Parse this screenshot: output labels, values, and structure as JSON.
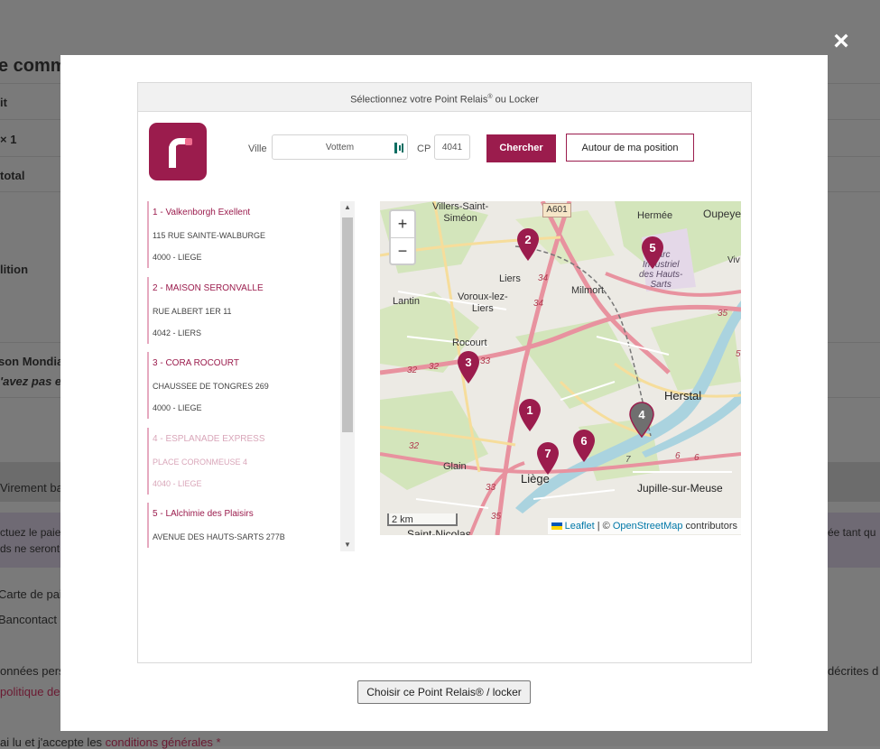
{
  "background": {
    "heading": "e comm",
    "rows": [
      "it",
      "× 1",
      "total",
      "lition",
      "son Mondia",
      "'avez pas e"
    ],
    "payment_row": "Virement ba",
    "note_left1": "ctuez le paie",
    "note_left2": "ds ne seront",
    "note_right": "ée tant qu",
    "card": "Carte de paie",
    "bancontact": "Bancontact",
    "privacy_left": "onnées pers",
    "privacy_link": "politique de",
    "privacy_right": "décrites d",
    "terms_text": "ai lu et j'accepte les",
    "terms_link": "conditions générales",
    "terms_star": "*"
  },
  "dialog": {
    "close_label": "×",
    "header_title": "Sélectionnez votre Point Relais",
    "header_reg": "®",
    "header_suffix": "ou Locker",
    "ville_label": "Ville",
    "ville_value": "Vottem",
    "cp_label": "CP",
    "cp_value": "4041",
    "search_label": "Chercher",
    "position_label": "Autour de ma position",
    "choose_label": "Choisir ce Point Relais® / locker",
    "points": [
      {
        "title": "1 - Valkenborgh Exellent",
        "street": "115 RUE SAINTE-WALBURGE",
        "city": "4000 - LIEGE",
        "disabled": false
      },
      {
        "title": "2 - MAISON SERONVALLE",
        "street": "RUE ALBERT 1ER 11",
        "city": "4042 - LIERS",
        "disabled": false
      },
      {
        "title": "3 - CORA ROCOURT",
        "street": "CHAUSSEE DE TONGRES 269",
        "city": "4000 - LIEGE",
        "disabled": false
      },
      {
        "title": "4 - ESPLANADE EXPRESS",
        "street": "PLACE CORONMEUSE 4",
        "city": "4040 - LIEGE",
        "disabled": true
      },
      {
        "title": "5 - LAlchimie des Plaisirs",
        "street": "AVENUE DES HAUTS-SARTS 277B",
        "city": "",
        "disabled": false
      }
    ]
  },
  "map": {
    "zoom_in": "+",
    "zoom_out": "−",
    "scale": "2 km",
    "attribution_link1": "Leaflet",
    "attribution_sep": " | © ",
    "attribution_link2": "OpenStreetMap",
    "attribution_tail": " contributors",
    "places": [
      "Villers-Saint-",
      "Siméon",
      "Hermée",
      "Oupeye",
      "Liers",
      "Milmort",
      "Lantin",
      "Voroux-lez-",
      "Liers",
      "Rocourt",
      "Herstal",
      "Glain",
      "Liège",
      "Jupille-sur-Meuse",
      "Saint-Nicolas",
      "Parc",
      "Industriel",
      "des Hauts-",
      "Sarts",
      "Viv",
      "A601",
      "34",
      "34",
      "35",
      "32",
      "32",
      "33",
      "32",
      "33",
      "35",
      "6",
      "6",
      "5",
      "7"
    ],
    "markers": [
      "1",
      "2",
      "3",
      "4",
      "5",
      "6",
      "7"
    ],
    "colors": {
      "marker": "#9b1c4d",
      "marker_disabled": "#6f6f6f",
      "road_major": "#e8929f",
      "road_secondary": "#f6dd9b",
      "green": "#cde3b0",
      "water": "#aad3df"
    }
  },
  "colors": {
    "brand": "#9b1c4d",
    "brand_light": "#f06c8f"
  }
}
